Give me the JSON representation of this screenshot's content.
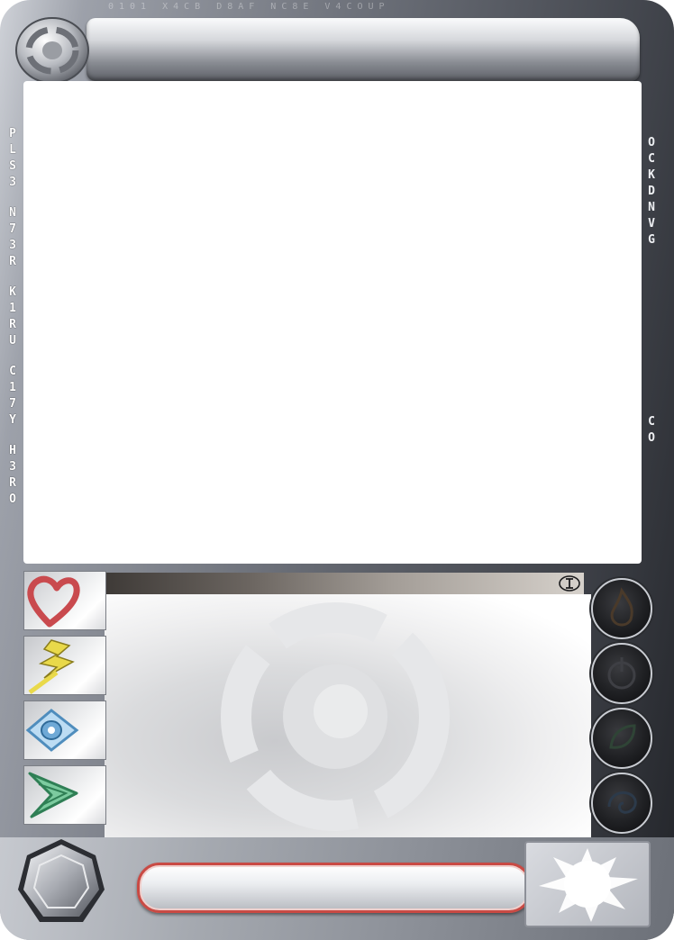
{
  "card": {
    "title": "",
    "name": ""
  },
  "side_text": {
    "left": [
      "P",
      "L",
      "S",
      "3",
      "N",
      "7",
      "3",
      "R",
      "K",
      "1",
      "R",
      "U",
      "C",
      "1",
      "7",
      "Y",
      "H",
      "3",
      "R",
      "O"
    ],
    "right_top": [
      "O",
      "C",
      "K",
      "D",
      "N",
      "V",
      "G"
    ],
    "right_mid": [
      "C",
      "O"
    ]
  },
  "stat_icons": [
    "heart-icon",
    "lightning-icon",
    "eye-icon",
    "wind-icon"
  ],
  "orb_icons": [
    "flame-icon",
    "power-icon",
    "leaf-icon",
    "swirl-icon"
  ],
  "colors": {
    "heart": "#c94a4e",
    "lightning": "#e9d94a",
    "eye": "#6fa9d6",
    "wind": "#3fa574",
    "name_border": "#c94a44"
  }
}
